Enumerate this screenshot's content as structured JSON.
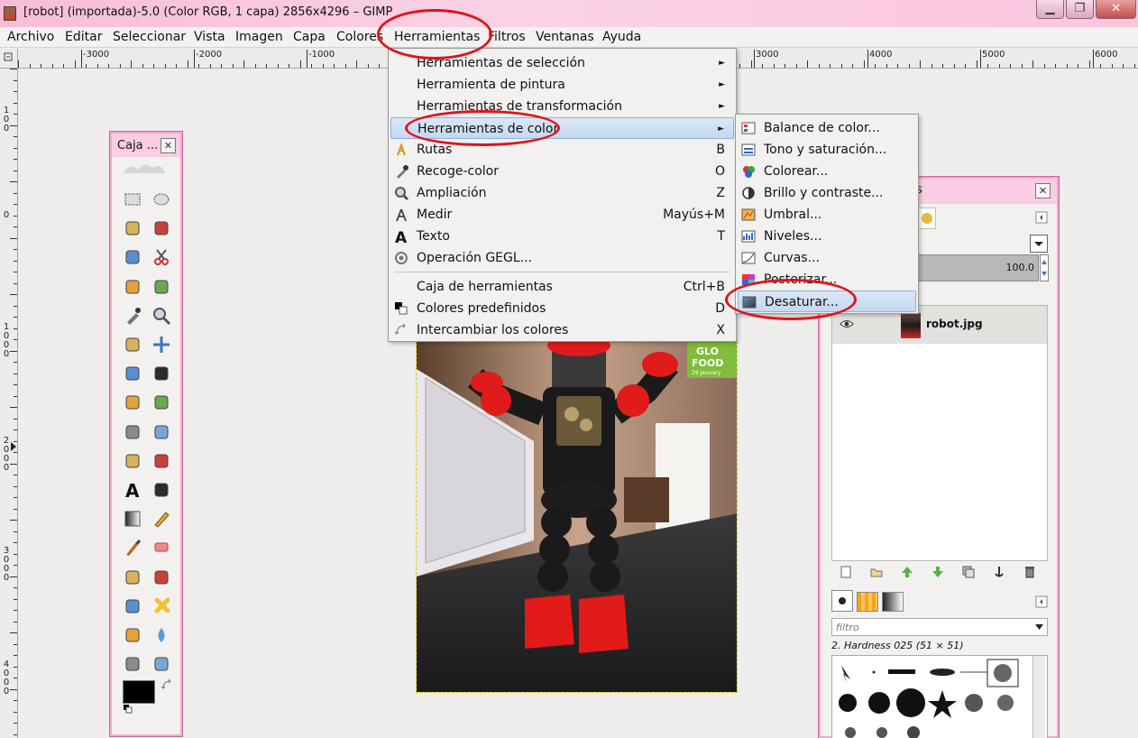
{
  "window": {
    "title": "[robot] (importada)-5.0 (Color RGB, 1 capa) 2856x4296 – GIMP",
    "min_label": "▁",
    "max_label": "❐",
    "close_label": "✕"
  },
  "menubar": [
    "Archivo",
    "Editar",
    "Seleccionar",
    "Vista",
    "Imagen",
    "Capa",
    "Colores",
    "Herramientas",
    "Filtros",
    "Ventanas",
    "Ayuda"
  ],
  "ruler_h": [
    "-3000",
    "-2000",
    "-1000",
    "3000",
    "4000",
    "5000",
    "6000"
  ],
  "ruler_v": [
    {
      "digits": [
        "1",
        "0",
        "0"
      ]
    },
    {
      "digits": [
        "0"
      ]
    },
    {
      "digits": [
        "1",
        "0",
        "0",
        "0"
      ]
    },
    {
      "digits": [
        "2",
        "0",
        "0",
        "0"
      ]
    },
    {
      "digits": [
        "3",
        "0",
        "0",
        "0"
      ]
    },
    {
      "digits": [
        "4",
        "0",
        "0",
        "0"
      ]
    }
  ],
  "toolbox": {
    "title": "Caja ...",
    "close": "✕"
  },
  "tools": [
    "rect-select",
    "ellipse-select",
    "free-select",
    "fuzzy-select",
    "color-select",
    "scissors",
    "foreground-select",
    "paths",
    "color-picker",
    "zoom",
    "measure",
    "move",
    "align",
    "crop",
    "rotate",
    "scale",
    "shear",
    "perspective",
    "flip",
    "cage",
    "text",
    "bucket-fill",
    "blend",
    "pencil",
    "paintbrush",
    "eraser",
    "airbrush",
    "ink",
    "clone",
    "heal",
    "perspective-clone",
    "blur",
    "smudge",
    "dodge-burn"
  ],
  "colors": {
    "fg": "#000000",
    "bg": "#ffffff",
    "accent_red": "#e0141c",
    "menu_highlight": "#c5d8f0",
    "title_pink": "#f9c6de"
  },
  "tools_menu": {
    "items": [
      {
        "label": "Herramientas de selección",
        "accel": "",
        "submenu": true,
        "icon": ""
      },
      {
        "label": "Herramienta de pintura",
        "accel": "",
        "submenu": true,
        "icon": ""
      },
      {
        "label": "Herramientas de transformación",
        "accel": "",
        "submenu": true,
        "icon": ""
      },
      {
        "label": "Herramientas de color",
        "accel": "",
        "submenu": true,
        "icon": "",
        "selected": true
      },
      {
        "label": "Rutas",
        "accel": "B",
        "submenu": false,
        "icon": "paths-icon"
      },
      {
        "label": "Recoge-color",
        "accel": "O",
        "submenu": false,
        "icon": "color-picker-icon"
      },
      {
        "label": "Ampliación",
        "accel": "Z",
        "submenu": false,
        "icon": "zoom-icon"
      },
      {
        "label": "Medir",
        "accel": "Mayús+M",
        "submenu": false,
        "icon": "measure-icon"
      },
      {
        "label": "Texto",
        "accel": "T",
        "submenu": false,
        "icon": "text-icon"
      },
      {
        "label": "Operación GEGL...",
        "accel": "",
        "submenu": false,
        "icon": "gegl-icon"
      },
      {
        "label": "Caja de herramientas",
        "accel": "Ctrl+B",
        "submenu": false,
        "icon": ""
      },
      {
        "label": "Colores predefinidos",
        "accel": "D",
        "submenu": false,
        "icon": "default-colors-icon"
      },
      {
        "label": "Intercambiar los colores",
        "accel": "X",
        "submenu": false,
        "icon": "swap-colors-icon"
      }
    ]
  },
  "color_submenu": {
    "items": [
      {
        "label": "Balance de color...",
        "icon": "color-balance-icon"
      },
      {
        "label": "Tono y saturación...",
        "icon": "hue-saturation-icon"
      },
      {
        "label": "Colorear...",
        "icon": "colorize-icon"
      },
      {
        "label": "Brillo y contraste...",
        "icon": "brightness-contrast-icon"
      },
      {
        "label": "Umbral...",
        "icon": "threshold-icon"
      },
      {
        "label": "Niveles...",
        "icon": "levels-icon"
      },
      {
        "label": "Curvas...",
        "icon": "curves-icon"
      },
      {
        "label": "Posterizar...",
        "icon": "posterize-icon"
      },
      {
        "label": "Desaturar...",
        "icon": "desaturate-icon",
        "selected": true
      }
    ]
  },
  "layers": {
    "title_fragment": "s",
    "close": "✕",
    "opacity": "100.0",
    "layer_name": "robot.jpg",
    "filter_placeholder": "filtro",
    "brush_name": "2. Hardness 025 (51 × 51)"
  },
  "canvas": {
    "sign_text": [
      "GLO",
      "FOOD"
    ],
    "sign_subtext": "29 January"
  }
}
